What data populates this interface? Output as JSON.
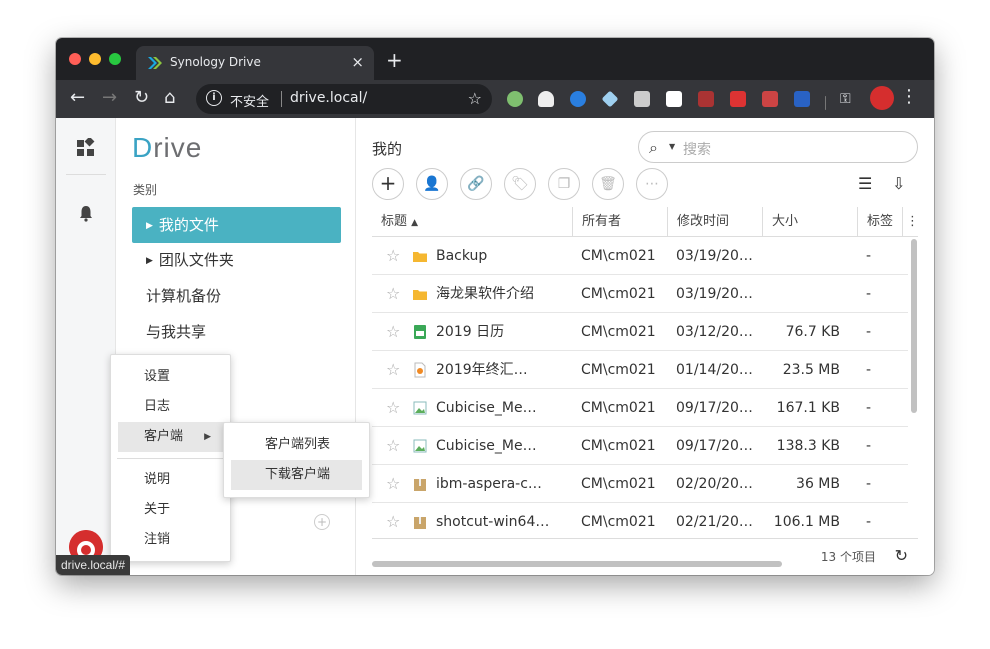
{
  "browser": {
    "tab_title": "Synology Drive",
    "tab_close": "×",
    "new_tab": "+",
    "insecure_label": "不安全",
    "url": "drive.local/",
    "status_url": "drive.local/#"
  },
  "sidebar": {
    "logo_d": "D",
    "logo_rest": "rive",
    "category_label": "类别",
    "items": [
      {
        "label": "我的文件"
      },
      {
        "label": "团队文件夹"
      },
      {
        "label": "计算机备份"
      },
      {
        "label": "与我共享"
      }
    ]
  },
  "main": {
    "breadcrumb": "我的",
    "search_placeholder": "搜索",
    "columns": [
      "标题",
      "所有者",
      "修改时间",
      "大小",
      "标签"
    ],
    "rows": [
      {
        "name": "Backup",
        "owner": "CM\\cm021",
        "modified": "03/19/20…",
        "size": "",
        "tag": "-",
        "icon": "folder-icon"
      },
      {
        "name": "海龙果软件介绍",
        "owner": "CM\\cm021",
        "modified": "03/19/20…",
        "size": "",
        "tag": "-",
        "icon": "folder-icon"
      },
      {
        "name": "2019 日历",
        "owner": "CM\\cm021",
        "modified": "03/12/20…",
        "size": "76.7 KB",
        "tag": "-",
        "icon": "spreadsheet-icon"
      },
      {
        "name": "2019年终汇…",
        "owner": "CM\\cm021",
        "modified": "01/14/20…",
        "size": "23.5 MB",
        "tag": "-",
        "icon": "presentation-icon"
      },
      {
        "name": "Cubicise_Me…",
        "owner": "CM\\cm021",
        "modified": "09/17/20…",
        "size": "167.1 KB",
        "tag": "-",
        "icon": "image-icon"
      },
      {
        "name": "Cubicise_Me…",
        "owner": "CM\\cm021",
        "modified": "09/17/20…",
        "size": "138.3 KB",
        "tag": "-",
        "icon": "image-icon"
      },
      {
        "name": "ibm-aspera-c…",
        "owner": "CM\\cm021",
        "modified": "02/20/20…",
        "size": "36 MB",
        "tag": "-",
        "icon": "archive-icon"
      },
      {
        "name": "shotcut-win64…",
        "owner": "CM\\cm021",
        "modified": "02/21/20…",
        "size": "106.1 MB",
        "tag": "-",
        "icon": "archive-icon"
      }
    ],
    "item_count": "13 个项目"
  },
  "context_menu": {
    "items": [
      "设置",
      "日志",
      "客户端",
      "说明",
      "关于",
      "注销"
    ],
    "submenu": [
      "客户端列表",
      "下载客户端"
    ]
  },
  "colors": {
    "accent": "#4ab2c2",
    "folder": "#f5b731"
  }
}
